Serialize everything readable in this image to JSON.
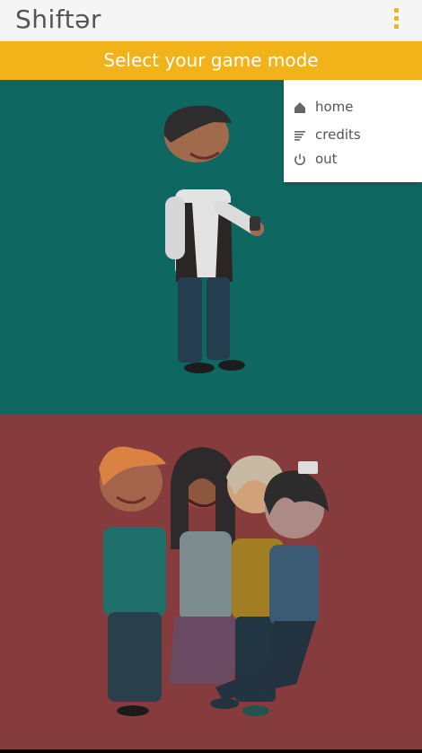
{
  "app": {
    "title": "Shiftər"
  },
  "banner": {
    "text": "Select your game mode"
  },
  "menu": {
    "items": [
      {
        "label": "home",
        "icon": "home-icon"
      },
      {
        "label": "credits",
        "icon": "credits-icon"
      },
      {
        "label": "out",
        "icon": "power-icon"
      }
    ]
  },
  "colors": {
    "accent": "#f1b21a",
    "single_mode_bg": "#0f6762",
    "multi_mode_bg": "#863b3d"
  }
}
